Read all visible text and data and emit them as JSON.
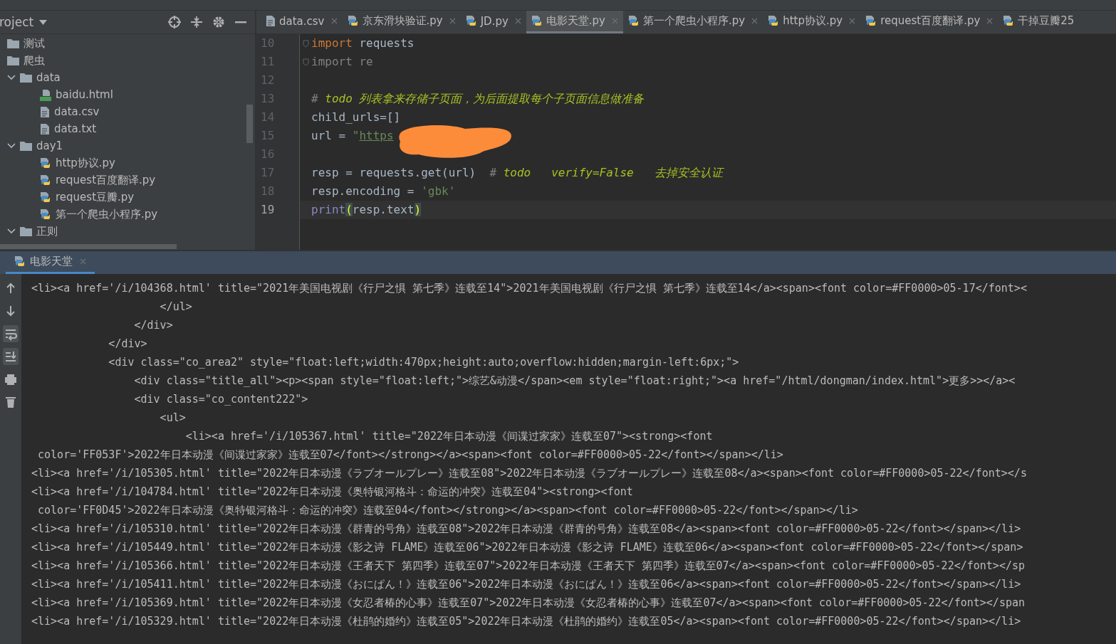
{
  "project_panel": {
    "title": "roject",
    "tree": [
      {
        "label": "测试",
        "kind": "folder"
      },
      {
        "label": "爬虫",
        "kind": "folder"
      },
      {
        "label": "data",
        "kind": "folder",
        "expanded": true,
        "children": [
          {
            "label": "baidu.html",
            "kind": "html"
          },
          {
            "label": "data.csv",
            "kind": "text"
          },
          {
            "label": "data.txt",
            "kind": "text"
          }
        ]
      },
      {
        "label": "day1",
        "kind": "folder",
        "expanded": true,
        "children": [
          {
            "label": "http协议.py",
            "kind": "python"
          },
          {
            "label": "request百度翻译.py",
            "kind": "python"
          },
          {
            "label": "request豆瓣.py",
            "kind": "python"
          },
          {
            "label": "第一个爬虫小程序.py",
            "kind": "python"
          }
        ]
      },
      {
        "label": "正则",
        "kind": "folder",
        "expanded": true
      }
    ]
  },
  "editor_tabs": [
    {
      "label": "data.csv",
      "kind": "text",
      "selected": false,
      "closable": true
    },
    {
      "label": "京东滑块验证.py",
      "kind": "python",
      "selected": false,
      "closable": true
    },
    {
      "label": "JD.py",
      "kind": "python",
      "selected": false,
      "closable": true
    },
    {
      "label": "电影天堂.py",
      "kind": "python",
      "selected": true,
      "closable": true
    },
    {
      "label": "第一个爬虫小程序.py",
      "kind": "python",
      "selected": false,
      "closable": true
    },
    {
      "label": "http协议.py",
      "kind": "python",
      "selected": false,
      "closable": true
    },
    {
      "label": "request百度翻译.py",
      "kind": "python",
      "selected": false,
      "closable": true
    },
    {
      "label": "干掉豆瓣25",
      "kind": "python",
      "selected": false,
      "closable": false
    }
  ],
  "editor": {
    "lines": [
      {
        "number": "10",
        "selected": false,
        "fold": true,
        "tokens": [
          {
            "text": "import",
            "kind": "keyword"
          },
          {
            "text": " requests",
            "kind": "plain"
          }
        ]
      },
      {
        "number": "11",
        "selected": false,
        "fold": true,
        "tokens": [
          {
            "text": "import re",
            "kind": "unused"
          }
        ]
      },
      {
        "number": "12",
        "selected": false
      },
      {
        "number": "13",
        "selected": false,
        "tokens": [
          {
            "text": "# ",
            "kind": "comment"
          },
          {
            "text": "todo 列表拿来存储子页面，为后面提取每个子页面信息做准备",
            "kind": "todo"
          }
        ]
      },
      {
        "number": "14",
        "selected": false,
        "tokens": [
          {
            "text": "child_urls=[]",
            "kind": "plain"
          }
        ]
      },
      {
        "number": "15",
        "selected": false,
        "tokens": [
          {
            "text": "url = ",
            "kind": "plain"
          },
          {
            "text": "\"",
            "kind": "string"
          },
          {
            "text": "https",
            "kind": "link"
          }
        ]
      },
      {
        "number": "16",
        "selected": false
      },
      {
        "number": "17",
        "selected": false,
        "tokens": [
          {
            "text": "resp = requests.get(url)  ",
            "kind": "plain"
          },
          {
            "text": "# ",
            "kind": "comment"
          },
          {
            "text": "todo   verify=False   去掉安全认证",
            "kind": "todo"
          }
        ]
      },
      {
        "number": "18",
        "selected": false,
        "tokens": [
          {
            "text": "resp.encoding = ",
            "kind": "plain"
          },
          {
            "text": "'gbk'",
            "kind": "string"
          }
        ]
      },
      {
        "number": "19",
        "selected": true,
        "tokens": [
          {
            "text": "print",
            "kind": "builtin"
          },
          {
            "text": "(",
            "kind": "brace"
          },
          {
            "text": "resp.text",
            "kind": "plain"
          },
          {
            "text": ")",
            "kind": "brace"
          }
        ]
      }
    ]
  },
  "run_panel": {
    "tab": {
      "label": "电影天堂",
      "selected": true
    },
    "toolbar": [
      {
        "kind": "up",
        "on": false
      },
      {
        "kind": "down",
        "on": false
      },
      {
        "kind": "wrap",
        "on": true
      },
      {
        "kind": "scroll-end",
        "on": true
      },
      {
        "kind": "print",
        "on": false
      },
      {
        "kind": "trash",
        "on": false
      }
    ],
    "output": [
      "<li><a href='/i/104368.html' title=\"2021年美国电视剧《行尸之惧 第七季》连载至14\">2021年美国电视剧《行尸之惧 第七季》连载至14</a><span><font color=#FF0000>05-17</font><",
      "                    </ul>",
      "                </div>",
      "            </div>",
      "            <div class=\"co_area2\" style=\"float:left;width:470px;height:auto;overflow:hidden;margin-left:6px;\">",
      "                <div class=\"title_all\"><p><span style=\"float:left;\">综艺&动漫</span><em style=\"float:right;\"><a href=\"/html/dongman/index.html\">更多>></a><",
      "                <div class=\"co_content222\">",
      "                    <ul>",
      "                        <li><a href='/i/105367.html' title=\"2022年日本动漫《间谍过家家》连载至07\"><strong><font",
      " color='FF053F'>2022年日本动漫《间谍过家家》连载至07</font></strong></a><span><font color=#FF0000>05-22</font></span></li>",
      "<li><a href='/i/105305.html' title=\"2022年日本动漫《ラブオールプレー》连载至08\">2022年日本动漫《ラブオールプレー》连载至08</a><span><font color=#FF0000>05-22</font></s",
      "<li><a href='/i/104784.html' title=\"2022年日本动漫《奥特银河格斗：命运的冲突》连载至04\"><strong><font",
      " color='FF0D45'>2022年日本动漫《奥特银河格斗：命运的冲突》连载至04</font></strong></a><span><font color=#FF0000>05-22</font></span></li>",
      "<li><a href='/i/105310.html' title=\"2022年日本动漫《群青的号角》连载至08\">2022年日本动漫《群青的号角》连载至08</a><span><font color=#FF0000>05-22</font></span></li>",
      "<li><a href='/i/105449.html' title=\"2022年日本动漫《影之诗 FLAME》连载至06\">2022年日本动漫《影之诗 FLAME》连载至06</a><span><font color=#FF0000>05-22</font></span>",
      "<li><a href='/i/105366.html' title=\"2022年日本动漫《王者天下 第四季》连载至07\">2022年日本动漫《王者天下 第四季》连载至07</a><span><font color=#FF0000>05-22</font></sp",
      "<li><a href='/i/105411.html' title=\"2022年日本动漫《おにぱん！》连载至06\">2022年日本动漫《おにぱん！》连载至06</a><span><font color=#FF0000>05-22</font></span></li>",
      "<li><a href='/i/105369.html' title=\"2022年日本动漫《女忍者椿的心事》连载至07\">2022年日本动漫《女忍者椿的心事》连载至07</a><span><font color=#FF0000>05-22</font></span",
      "<li><a href='/i/105329.html' title=\"2022年日本动漫《杜鹃的婚约》连载至05\">2022年日本动漫《杜鹃的婚约》连载至05</a><span><font color=#FF0000>05-22</font></span></li>"
    ]
  }
}
